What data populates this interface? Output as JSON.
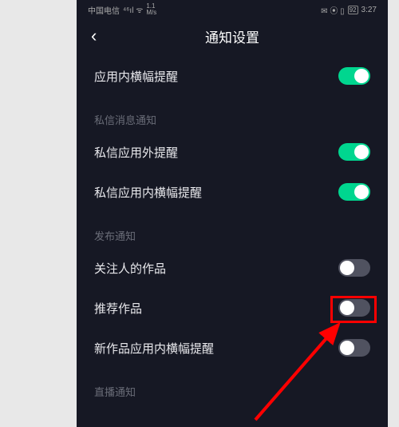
{
  "status": {
    "carrier": "中国电信",
    "signal_icons": "⁴⁶ıl ᯤ",
    "speed_top": "1.1",
    "speed_bottom": "M/s",
    "icons_right": "✉ ⦿ ▯",
    "battery": "92",
    "time": "3:27"
  },
  "nav": {
    "title": "通知设置"
  },
  "row1": {
    "label": "应用内横幅提醒"
  },
  "section_private": "私信消息通知",
  "row2": {
    "label": "私信应用外提醒"
  },
  "row3": {
    "label": "私信应用内横幅提醒"
  },
  "section_publish": "发布通知",
  "row4": {
    "label": "关注人的作品"
  },
  "row5": {
    "label": "推荐作品"
  },
  "row6": {
    "label": "新作品应用内横幅提醒"
  },
  "section_live": "直播通知",
  "toggles": {
    "row1": "on",
    "row2": "on",
    "row3": "on",
    "row4": "off",
    "row5": "off",
    "row6": "off"
  }
}
